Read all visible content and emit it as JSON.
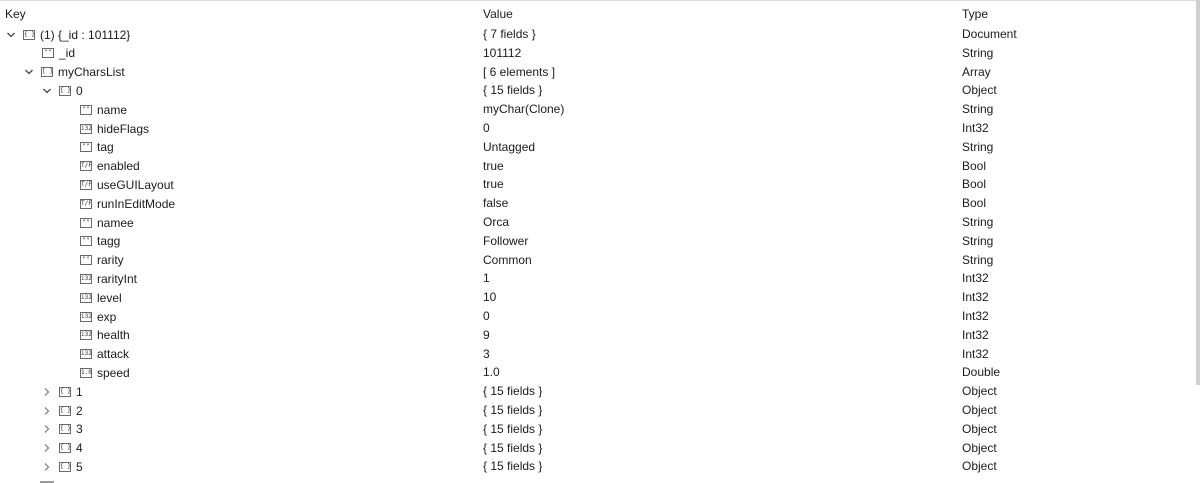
{
  "columns": {
    "key": "Key",
    "value": "Value",
    "type": "Type"
  },
  "rows": [
    {
      "key": "(1) {_id : 101112}",
      "value": "{ 7 fields }",
      "type": "Document",
      "chevron": "down",
      "icon": "{ }"
    },
    {
      "key": "_id",
      "value": "101112",
      "type": "String",
      "chevron": "none",
      "icon": "\"\""
    },
    {
      "key": "myCharsList",
      "value": "[ 6 elements ]",
      "type": "Array",
      "chevron": "down",
      "icon": "[ ]"
    },
    {
      "key": "0",
      "value": "{ 15 fields }",
      "type": "Object",
      "chevron": "down",
      "icon": "{ }"
    },
    {
      "key": "name",
      "value": "myChar(Clone)",
      "type": "String",
      "chevron": "none",
      "icon": "\"\""
    },
    {
      "key": "hideFlags",
      "value": "0",
      "type": "Int32",
      "chevron": "none",
      "icon": "i32"
    },
    {
      "key": "tag",
      "value": "Untagged",
      "type": "String",
      "chevron": "none",
      "icon": "\"\""
    },
    {
      "key": "enabled",
      "value": "true",
      "type": "Bool",
      "chevron": "none",
      "icon": "T/F"
    },
    {
      "key": "useGUILayout",
      "value": "true",
      "type": "Bool",
      "chevron": "none",
      "icon": "T/F"
    },
    {
      "key": "runInEditMode",
      "value": "false",
      "type": "Bool",
      "chevron": "none",
      "icon": "T/F"
    },
    {
      "key": "namee",
      "value": "Orca",
      "type": "String",
      "chevron": "none",
      "icon": "\"\""
    },
    {
      "key": "tagg",
      "value": "Follower",
      "type": "String",
      "chevron": "none",
      "icon": "\"\""
    },
    {
      "key": "rarity",
      "value": "Common",
      "type": "String",
      "chevron": "none",
      "icon": "\"\""
    },
    {
      "key": "rarityInt",
      "value": "1",
      "type": "Int32",
      "chevron": "none",
      "icon": "i32"
    },
    {
      "key": "level",
      "value": "10",
      "type": "Int32",
      "chevron": "none",
      "icon": "i32"
    },
    {
      "key": "exp",
      "value": "0",
      "type": "Int32",
      "chevron": "none",
      "icon": "i32"
    },
    {
      "key": "health",
      "value": "9",
      "type": "Int32",
      "chevron": "none",
      "icon": "i32"
    },
    {
      "key": "attack",
      "value": "3",
      "type": "Int32",
      "chevron": "none",
      "icon": "i32"
    },
    {
      "key": "speed",
      "value": "1.0",
      "type": "Double",
      "chevron": "none",
      "icon": "1.0"
    },
    {
      "key": "1",
      "value": "{ 15 fields }",
      "type": "Object",
      "chevron": "right",
      "icon": "{ }"
    },
    {
      "key": "2",
      "value": "{ 15 fields }",
      "type": "Object",
      "chevron": "right",
      "icon": "{ }"
    },
    {
      "key": "3",
      "value": "{ 15 fields }",
      "type": "Object",
      "chevron": "right",
      "icon": "{ }"
    },
    {
      "key": "4",
      "value": "{ 15 fields }",
      "type": "Object",
      "chevron": "right",
      "icon": "{ }"
    },
    {
      "key": "5",
      "value": "{ 15 fields }",
      "type": "Object",
      "chevron": "right",
      "icon": "{ }"
    }
  ]
}
